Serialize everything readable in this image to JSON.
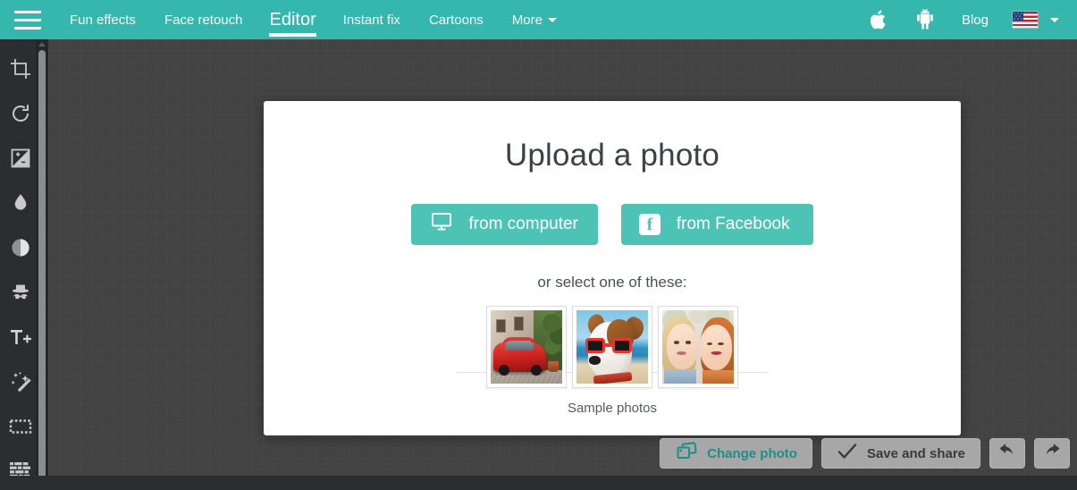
{
  "header": {
    "menu_icon": "hamburger-icon",
    "nav": [
      {
        "label": "Fun effects",
        "active": false,
        "has_caret": false
      },
      {
        "label": "Face retouch",
        "active": false,
        "has_caret": false
      },
      {
        "label": "Editor",
        "active": true,
        "has_caret": false
      },
      {
        "label": "Instant fix",
        "active": false,
        "has_caret": false
      },
      {
        "label": "Cartoons",
        "active": false,
        "has_caret": false
      },
      {
        "label": "More",
        "active": false,
        "has_caret": true
      }
    ],
    "apple_icon": "apple-icon",
    "android_icon": "android-icon",
    "blog_label": "Blog",
    "flag_icon": "us-flag-icon",
    "flag_caret": "chevron-down-icon",
    "bg_color": "#35b7ad"
  },
  "sidebar": {
    "tools": [
      {
        "name": "crop-tool"
      },
      {
        "name": "rotate-tool"
      },
      {
        "name": "exposure-tool"
      },
      {
        "name": "blur-droplet-tool"
      },
      {
        "name": "contrast-tool"
      },
      {
        "name": "stickers-mustache-tool"
      },
      {
        "name": "text-tool"
      },
      {
        "name": "magic-wand-tool"
      },
      {
        "name": "frames-tool"
      },
      {
        "name": "textures-tool"
      }
    ],
    "bg_color": "#2b2d30"
  },
  "modal": {
    "title": "Upload a photo",
    "buttons": [
      {
        "label": "from computer",
        "icon": "monitor-icon"
      },
      {
        "label": "from Facebook",
        "icon": "facebook-icon"
      }
    ],
    "or_text": "or select one of these:",
    "samples_label": "Sample photos",
    "samples": [
      {
        "alt": "red car in alley"
      },
      {
        "alt": "dog with sunglasses"
      },
      {
        "alt": "two women laughing"
      }
    ],
    "accent_color": "#4cc3b4"
  },
  "bottom_toolbar": {
    "change_photo_label": "Change photo",
    "change_photo_icon": "photos-icon",
    "save_share_label": "Save and share",
    "save_share_icon": "check-icon",
    "undo_icon": "undo-arrow-icon",
    "redo_icon": "redo-arrow-icon"
  }
}
